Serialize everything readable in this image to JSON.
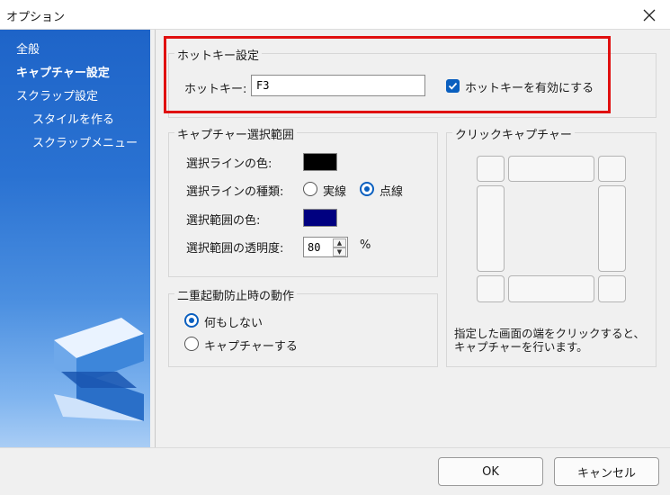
{
  "window": {
    "title": "オプション"
  },
  "sidebar": {
    "items": [
      {
        "label": "全般"
      },
      {
        "label": "キャプチャー設定"
      },
      {
        "label": "スクラップ設定"
      },
      {
        "label": "スタイルを作る"
      },
      {
        "label": "スクラップメニュー"
      }
    ],
    "active": "キャプチャー設定"
  },
  "hotkey": {
    "group_title": "ホットキー設定",
    "label": "ホットキー:",
    "value": "F3",
    "enable_label": "ホットキーを有効にする",
    "enabled": true
  },
  "selection": {
    "group_title": "キャプチャー選択範囲",
    "line_color_label": "選択ラインの色:",
    "line_color": "#000000",
    "line_type_label": "選択ラインの種類:",
    "line_type_solid": "実線",
    "line_type_dotted": "点線",
    "line_type_selected": "点線",
    "area_color_label": "選択範囲の色:",
    "area_color": "#000080",
    "opacity_label": "選択範囲の透明度:",
    "opacity_value": "80",
    "opacity_unit": "%"
  },
  "duplicate": {
    "group_title": "二重起動防止時の動作",
    "option_none": "何もしない",
    "option_capture": "キャプチャーする",
    "selected": "何もしない"
  },
  "click_capture": {
    "group_title": "クリックキャプチャー",
    "description_line1": "指定した画面の端をクリックすると、",
    "description_line2": "キャプチャーを行います。"
  },
  "buttons": {
    "ok": "OK",
    "cancel": "キャンセル"
  },
  "colors": {
    "accent": "#0a5fbf",
    "sidebar_top": "#1e64c8",
    "highlight": "#e01010"
  }
}
